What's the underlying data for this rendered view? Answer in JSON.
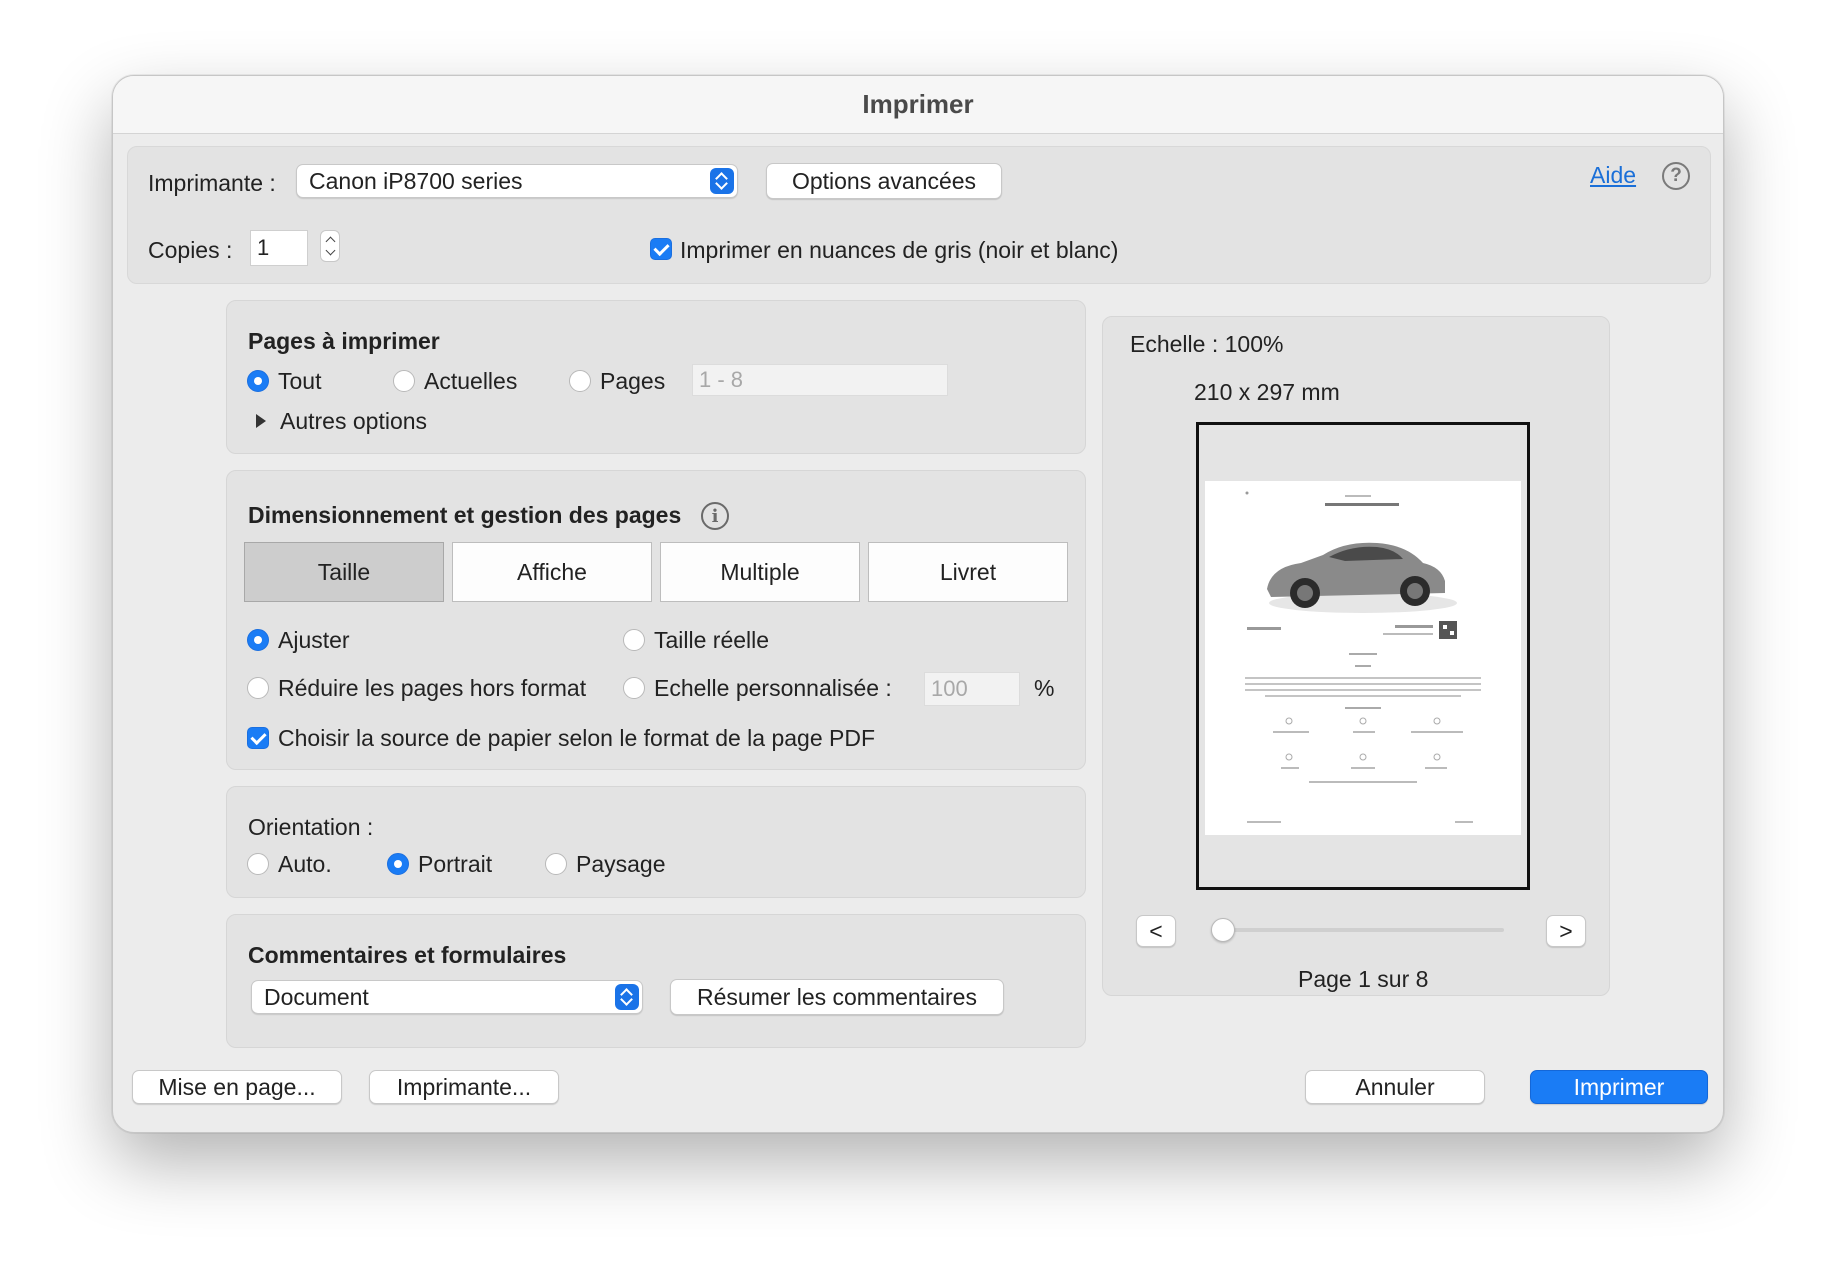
{
  "window": {
    "title": "Imprimer"
  },
  "printer": {
    "label": "Imprimante :",
    "selected": "Canon iP8700 series",
    "advanced_button": "Options avancées"
  },
  "help": {
    "link": "Aide",
    "icon_glyph": "?"
  },
  "copies": {
    "label": "Copies :",
    "value": "1"
  },
  "grayscale": {
    "label": "Imprimer en nuances de gris (noir et blanc)",
    "checked": true
  },
  "pages_group": {
    "title": "Pages à imprimer",
    "options": [
      "Tout",
      "Actuelles",
      "Pages"
    ],
    "selected": "Tout",
    "range_placeholder": "1 - 8",
    "more_options": "Autres options"
  },
  "sizing_group": {
    "title": "Dimensionnement et gestion des pages",
    "info_glyph": "i",
    "tabs": [
      "Taille",
      "Affiche",
      "Multiple",
      "Livret"
    ],
    "selected_tab": "Taille",
    "fit": "Ajuster",
    "actual_size": "Taille réelle",
    "shrink": "Réduire les pages hors format",
    "custom_scale": "Echelle personnalisée :",
    "scale_value": "100",
    "percent": "%",
    "selected_option": "Ajuster",
    "paper_source": "Choisir la source de papier selon le format de la page PDF",
    "paper_source_checked": true
  },
  "orientation": {
    "label": "Orientation :",
    "options": [
      "Auto.",
      "Portrait",
      "Paysage"
    ],
    "selected": "Portrait"
  },
  "comments": {
    "title": "Commentaires et formulaires",
    "selected": "Document",
    "summarize_button": "Résumer les commentaires"
  },
  "preview": {
    "scale": "Echelle : 100%",
    "size": "210 x 297 mm",
    "prev": "<",
    "next": ">",
    "page_indicator": "Page 1 sur 8",
    "current_page": 1,
    "total_pages": 8
  },
  "footer": {
    "page_setup": "Mise en page...",
    "printer_button": "Imprimante...",
    "cancel": "Annuler",
    "print": "Imprimer"
  },
  "colors": {
    "accent": "#1a7cf5",
    "link": "#1a6fd8"
  }
}
